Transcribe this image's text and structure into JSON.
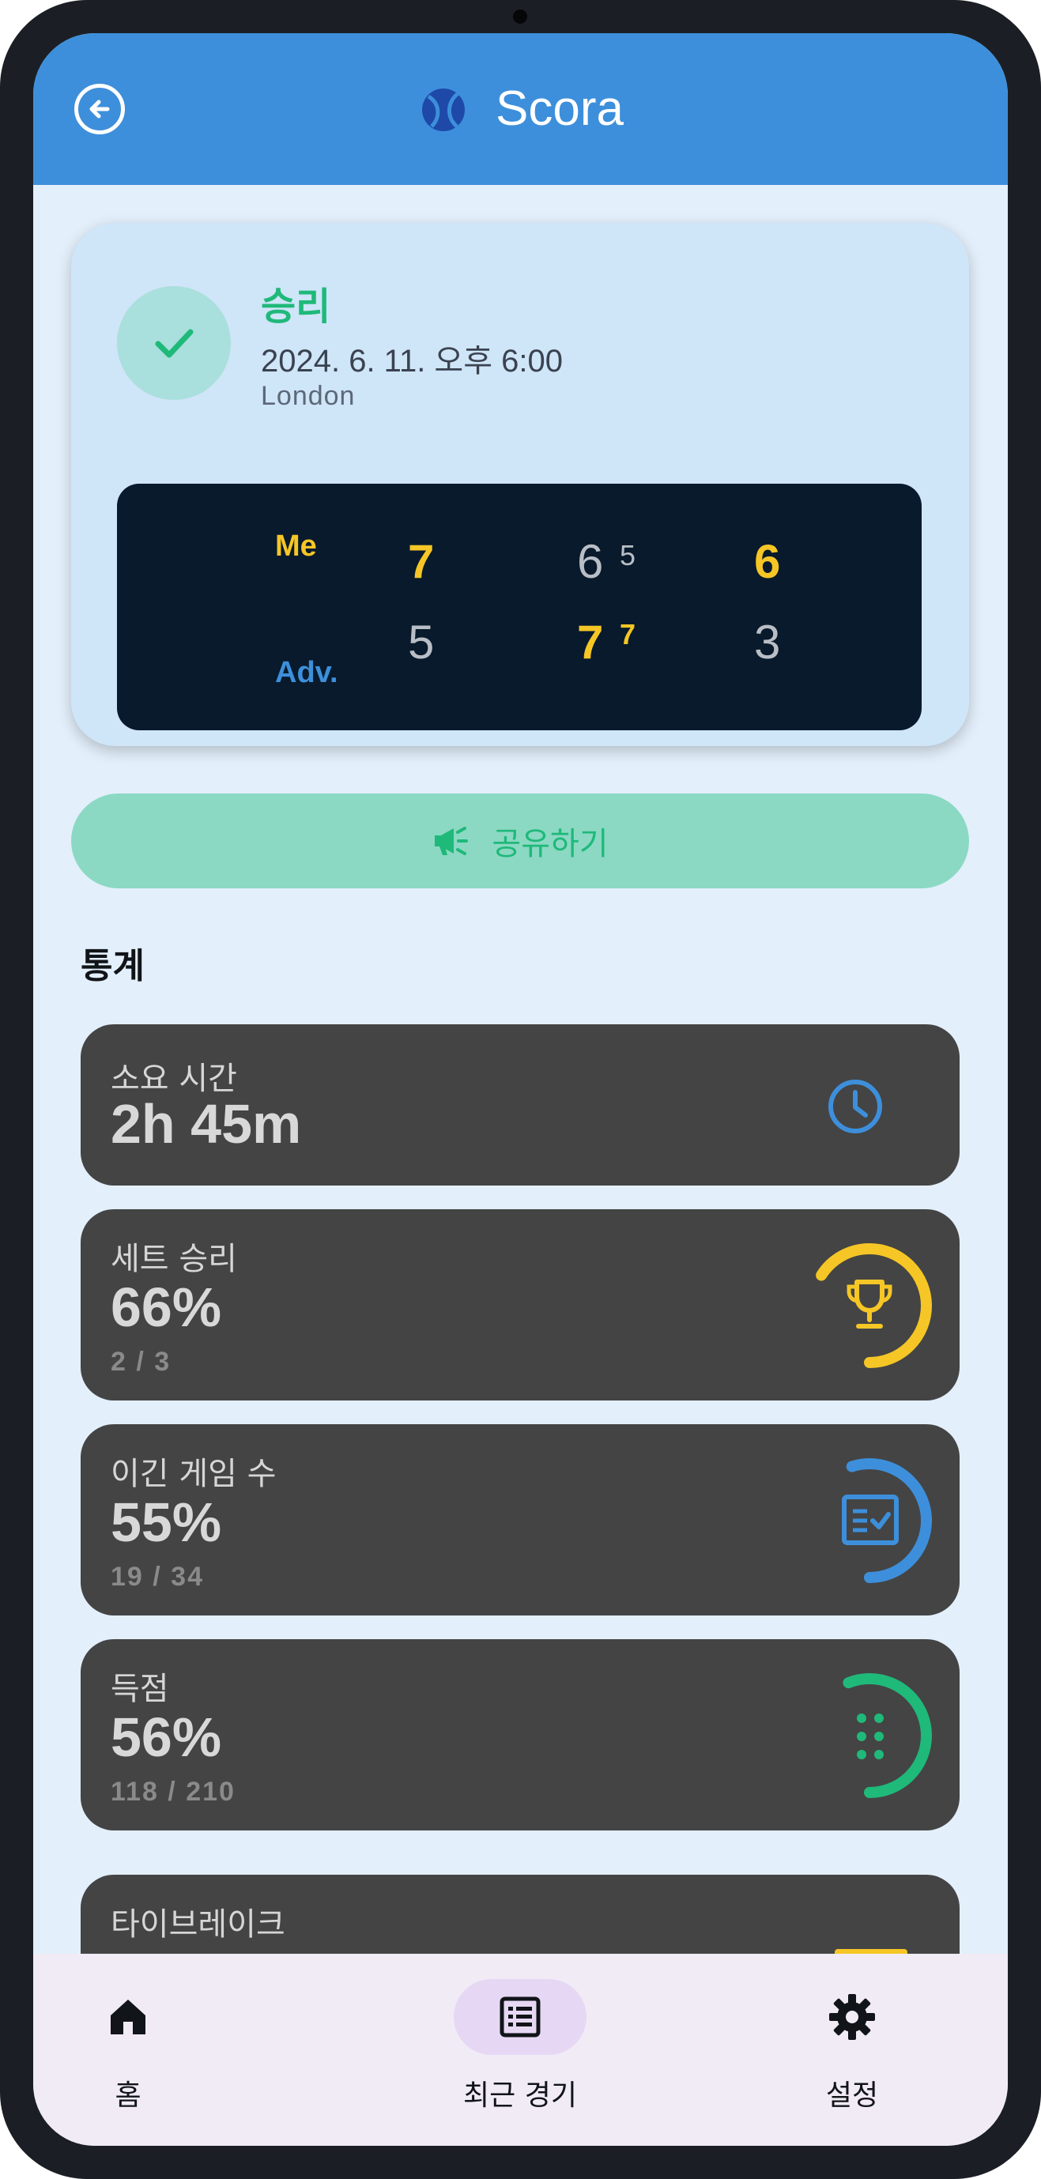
{
  "app": {
    "title": "Scora"
  },
  "colors": {
    "primary": "#3d8fdb",
    "win_green": "#1fb97a",
    "gold": "#f5c625",
    "scoreboard_bg": "#081a2c",
    "stat_card_bg": "#444444"
  },
  "match": {
    "result": "승리",
    "datetime": "2024. 6. 11. 오후 6:00",
    "location": "London",
    "players": {
      "me": "Me",
      "adv": "Adv."
    },
    "sets": [
      {
        "me": "7",
        "adv": "5",
        "winner": "me"
      },
      {
        "me": "6",
        "me_tiebreak": "5",
        "adv": "7",
        "adv_tiebreak": "7",
        "winner": "adv"
      },
      {
        "me": "6",
        "adv": "3",
        "winner": "me"
      }
    ]
  },
  "share": {
    "label": "공유하기",
    "icon": "megaphone-icon"
  },
  "stats": {
    "title": "통계",
    "items": [
      {
        "label": "소요 시간",
        "value": "2h 45m",
        "sub": "",
        "icon": "clock-icon"
      },
      {
        "label": "세트 승리",
        "value": "66%",
        "sub": "2 / 3",
        "icon": "trophy-icon",
        "progress": 0.66,
        "color": "#f5c625"
      },
      {
        "label": "이긴 게임 수",
        "value": "55%",
        "sub": "19 / 34",
        "icon": "scoresheet-icon",
        "progress": 0.55,
        "color": "#3d8fdb"
      },
      {
        "label": "득점",
        "value": "56%",
        "sub": "118 / 210",
        "icon": "dots-grid-icon",
        "progress": 0.56,
        "color": "#1fb97a"
      },
      {
        "label": "타이브레이크",
        "value": "",
        "sub": "",
        "icon": ""
      }
    ]
  },
  "nav": {
    "items": [
      {
        "label": "홈",
        "icon": "home-icon",
        "active": false
      },
      {
        "label": "최근 경기",
        "icon": "list-icon",
        "active": true
      },
      {
        "label": "설정",
        "icon": "gear-icon",
        "active": false
      }
    ]
  }
}
